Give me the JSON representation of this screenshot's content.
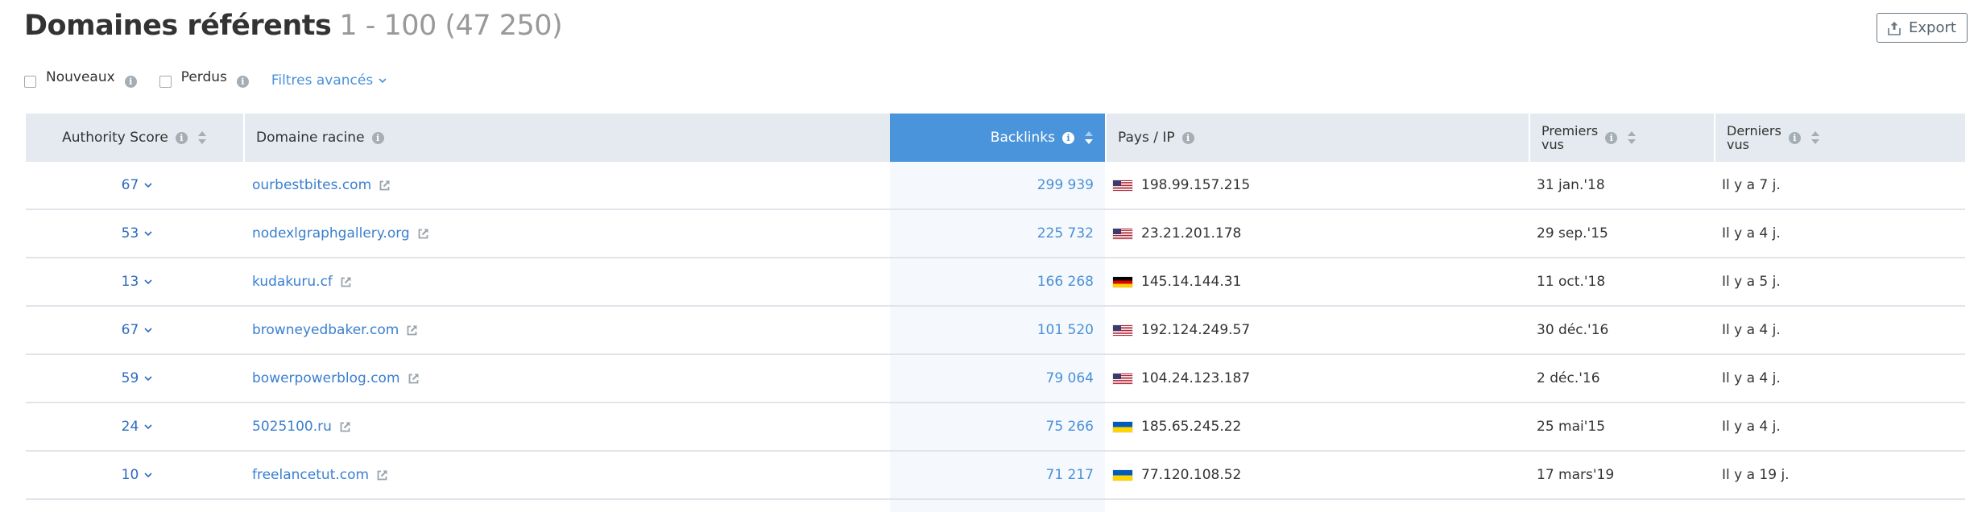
{
  "header": {
    "title": "Domaines référents",
    "range": "1 - 100 (47 250)",
    "export_label": "Export"
  },
  "filters": {
    "new_label": "Nouveaux",
    "new_checked": false,
    "lost_label": "Perdus",
    "lost_checked": false,
    "advanced_label": "Filtres avancés"
  },
  "table": {
    "columns": {
      "authority_score": "Authority Score",
      "root_domain": "Domaine racine",
      "backlinks": "Backlinks",
      "country_ip": "Pays / IP",
      "first_seen_line1": "Premiers",
      "first_seen_line2": "vus",
      "last_seen_line1": "Derniers",
      "last_seen_line2": "vus"
    },
    "active_sort": {
      "column": "backlinks",
      "direction": "desc"
    },
    "rows": [
      {
        "score": "67",
        "domain": "ourbestbites.com",
        "backlinks": "299 939",
        "country": "us",
        "ip": "198.99.157.215",
        "first_seen": "31 jan.'18",
        "last_seen": "Il y a 7 j."
      },
      {
        "score": "53",
        "domain": "nodexlgraphgallery.org",
        "backlinks": "225 732",
        "country": "us",
        "ip": "23.21.201.178",
        "first_seen": "29 sep.'15",
        "last_seen": "Il y a 4 j."
      },
      {
        "score": "13",
        "domain": "kudakuru.cf",
        "backlinks": "166 268",
        "country": "de",
        "ip": "145.14.144.31",
        "first_seen": "11 oct.'18",
        "last_seen": "Il y a 5 j."
      },
      {
        "score": "67",
        "domain": "browneyedbaker.com",
        "backlinks": "101 520",
        "country": "us",
        "ip": "192.124.249.57",
        "first_seen": "30 déc.'16",
        "last_seen": "Il y a 4 j."
      },
      {
        "score": "59",
        "domain": "bowerpowerblog.com",
        "backlinks": "79 064",
        "country": "us",
        "ip": "104.24.123.187",
        "first_seen": "2 déc.'16",
        "last_seen": "Il y a 4 j."
      },
      {
        "score": "24",
        "domain": "5025100.ru",
        "backlinks": "75 266",
        "country": "ua",
        "ip": "185.65.245.22",
        "first_seen": "25 mai'15",
        "last_seen": "Il y a 4 j."
      },
      {
        "score": "10",
        "domain": "freelancetut.com",
        "backlinks": "71 217",
        "country": "ua",
        "ip": "77.120.108.52",
        "first_seen": "17 mars'19",
        "last_seen": "Il y a 19 j."
      }
    ]
  },
  "icons": {
    "info": "i",
    "export": "upload-icon",
    "chevron": "chevron-down-icon",
    "external_link": "external-link-icon",
    "sort": "sort-icon"
  },
  "colors": {
    "accent": "#4a94db",
    "link": "#3a7fcf",
    "header_bg": "#e4eaef",
    "active_column_bg": "#f5f9fd"
  }
}
